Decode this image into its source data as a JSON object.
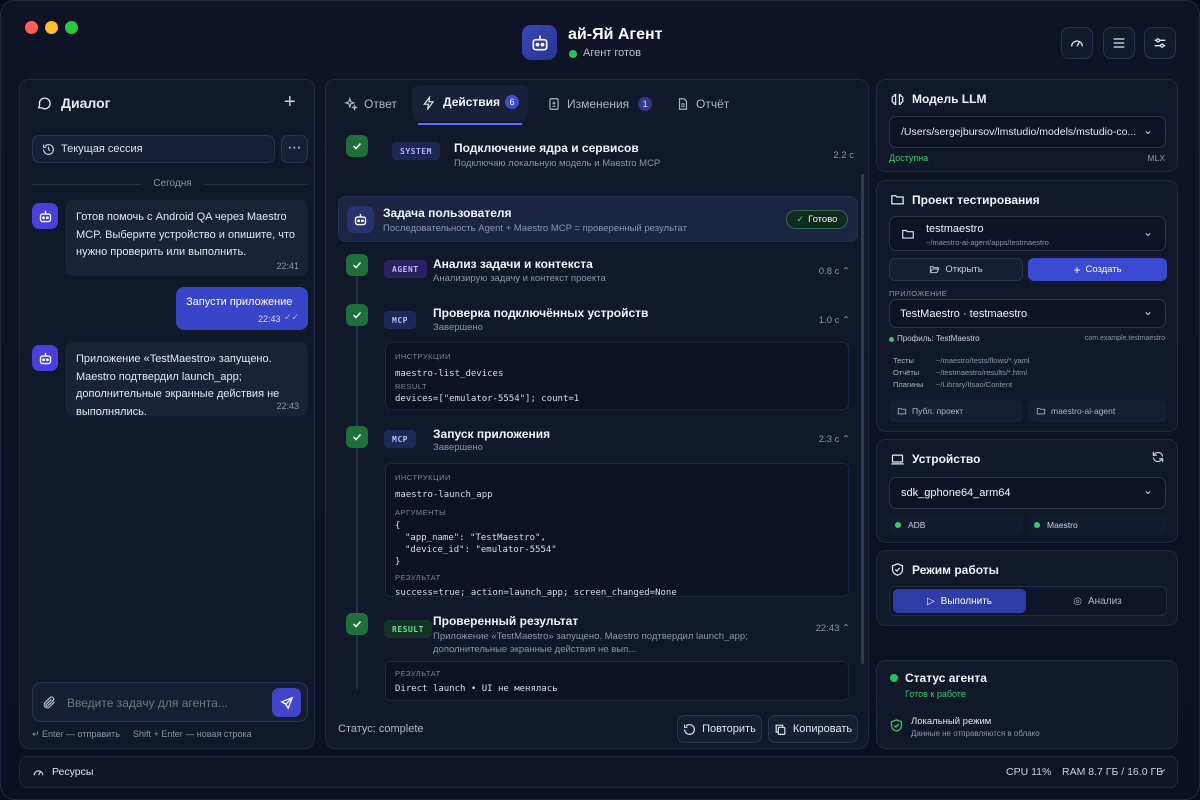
{
  "header": {
    "title": "ай-Яй Агент",
    "status": "Агент готов"
  },
  "dialog": {
    "title": "Диалог",
    "session_label": "Текущая сессия",
    "date_divider": "Сегодня",
    "messages": [
      {
        "role": "agent",
        "text": "Готов помочь с Android QA через Maestro MCP. Выберите устройство и опишите, что нужно проверить или выполнить.",
        "time": "22:41"
      },
      {
        "role": "user",
        "text": "Запусти приложение",
        "time": "22:43"
      },
      {
        "role": "agent",
        "text": "Приложение «TestMaestro» запущено. Maestro подтвердил launch_app; дополнительные экранные действия не выполнялись.",
        "time": "22:43"
      }
    ],
    "input_placeholder": "Введите задачу для агента...",
    "hint_enter": "↵ Enter — отправить",
    "hint_shift": "Shift + Enter — новая строка"
  },
  "tabs": {
    "answer": "Ответ",
    "actions": "Действия",
    "actions_count": "6",
    "changes": "Изменения",
    "changes_count": "1",
    "report": "Отчёт"
  },
  "steps": {
    "s0": {
      "badge": "SYSTEM",
      "title": "Подключение ядра и сервисов",
      "sub": "Подключаю локальную модель и Maestro MCP",
      "time": "2.2 с"
    },
    "task": {
      "title": "Задача пользователя",
      "sub": "Последовательность Agent + Maestro MCP = проверенный результат",
      "status": "Готово"
    },
    "s1": {
      "badge": "AGENT",
      "title": "Анализ задачи и контекста",
      "sub": "Анализирую задачу и контекст проекта",
      "time": "0.8 с"
    },
    "s2": {
      "badge": "MCP",
      "title": "Проверка подключённых устройств",
      "sub": "Завершено",
      "time": "1.0 с",
      "l_instr": "ИНСТРУКЦИИ",
      "instr": "maestro-list_devices",
      "l_res": "RESULT",
      "res": "devices=[\"emulator-5554\"]; count=1"
    },
    "s3": {
      "badge": "MCP",
      "title": "Запуск приложения",
      "sub": "Завершено",
      "time": "2.3 с",
      "l_instr": "ИНСТРУКЦИИ",
      "instr": "maestro-launch_app",
      "l_args": "АРГУМЕНТЫ",
      "arg_open": "{",
      "arg1": "\"app_name\": \"TestMaestro\",",
      "arg2": "\"device_id\": \"emulator-5554\"",
      "arg_close": "}",
      "l_res": "РЕЗУЛЬТАТ",
      "res": "success=true; action=launch_app; screen_changed=None"
    },
    "s4": {
      "badge": "RESULT",
      "title": "Проверенный результат",
      "sub1": "Приложение «TestMaestro» запущено. Maestro подтвердил launch_app;",
      "sub2": "дополнительные экранные действия не вып...",
      "time": "22:43",
      "l_res": "РЕЗУЛЬТАТ",
      "res": "Direct launch • UI не менялась"
    }
  },
  "footer_mid": {
    "status": "Статус: complete",
    "retry": "Повторить",
    "copy": "Копировать"
  },
  "llm": {
    "title": "Модель LLM",
    "path": "/Users/sergejbursov/lmstudio/models/mstudio-co...",
    "state": "Доступна",
    "format": "MLX"
  },
  "project": {
    "title": "Проект тестирования",
    "name": "testmaestro",
    "path": "~/maestro-ai-agent/apps/testmaestro",
    "open": "Открыть",
    "create": "Создать",
    "app_label": "ПРИЛОЖЕНИЕ",
    "app": "TestMaestro · testmaestro",
    "profile": "Профиль: TestMaestro",
    "package": "com.example.testmaestro",
    "rows": [
      {
        "k": "Тесты",
        "v": "~/maestro/tests/flows/*.yaml"
      },
      {
        "k": "Отчёты",
        "v": "~/testmaestro/results/*.html"
      },
      {
        "k": "Плагины",
        "v": "~/Library/Itsao/Content"
      }
    ],
    "chip1": "Публ. проект",
    "chip2": "maestro-ai-agent"
  },
  "device": {
    "title": "Устройство",
    "name": "sdk_gphone64_arm64",
    "adb": "ADB",
    "maestro": "Maestro"
  },
  "mode": {
    "title": "Режим работы",
    "run": "Выполнить",
    "analyze": "Анализ"
  },
  "agent_status": {
    "title": "Статус агента",
    "state": "Готов к работе",
    "local_title": "Локальный режим",
    "local_sub": "Данные не отправляются в облако"
  },
  "statusbar": {
    "resources": "Ресурсы",
    "cpu": "CPU 11%",
    "ram": "RAM 8.7 ГБ / 16.0 ГБ"
  }
}
